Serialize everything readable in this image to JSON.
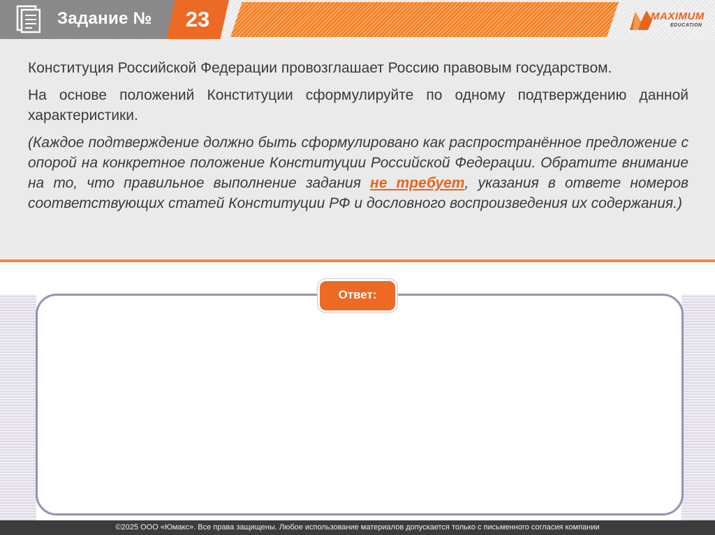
{
  "header": {
    "title": "Задание №",
    "number": "23",
    "icon": "document-icon"
  },
  "logo": {
    "word": "MAXIMUM",
    "sub": "EDUCATION",
    "color": "#e8641c"
  },
  "task": {
    "p1": "Конституция Российской Федерации провозглашает Россию правовым государством.",
    "p2": "На основе положений Конституции сформулируйте по одному подтверждению данной характеристики.",
    "p3_before": "(Каждое подтверждение должно быть сформулировано как распространённое предложение с опорой на конкретное положение Конституции Российской Федерации. Обратите внимание на то, что правильное выполнение задания ",
    "p3_highlight": "не требует",
    "p3_after": ", указания в ответе номеров соответствующих статей Конституции РФ и дословного воспроизведения их содержания.)"
  },
  "answer": {
    "label": "Ответ:"
  },
  "footer": {
    "text": "©2025 ООО «Юмакс». Все права защищены. Любое использование материалов допускается только с письменного согласия компании"
  },
  "colors": {
    "accent": "#ec6a23",
    "header_gray": "#8a8a8a",
    "answer_border": "#9a8fb3",
    "footer_bg": "#3c3c3c"
  }
}
